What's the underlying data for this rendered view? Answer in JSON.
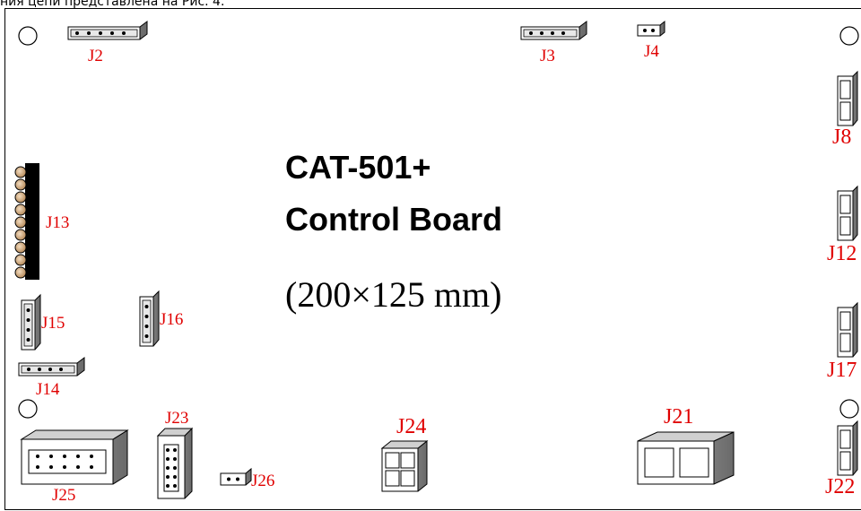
{
  "caption": "ния цепи представлена на Рис. 4.",
  "board": {
    "title_line1": "CAT-501+",
    "title_line2": "Control Board",
    "dimensions": "(200×125  mm)"
  },
  "labels": {
    "j2": "J2",
    "j3": "J3",
    "j4": "J4",
    "j8": "J8",
    "j12": "J12",
    "j13": "J13",
    "j14": "J14",
    "j15": "J15",
    "j16": "J16",
    "j17": "J17",
    "j21": "J21",
    "j22": "J22",
    "j23": "J23",
    "j24": "J24",
    "j25": "J25",
    "j26": "J26"
  },
  "colors": {
    "label": "#e00000",
    "outline": "#000000",
    "connector_side": "#8a8a8a",
    "connector_top": "#d0d0d0",
    "peg": "#d8b48a"
  }
}
